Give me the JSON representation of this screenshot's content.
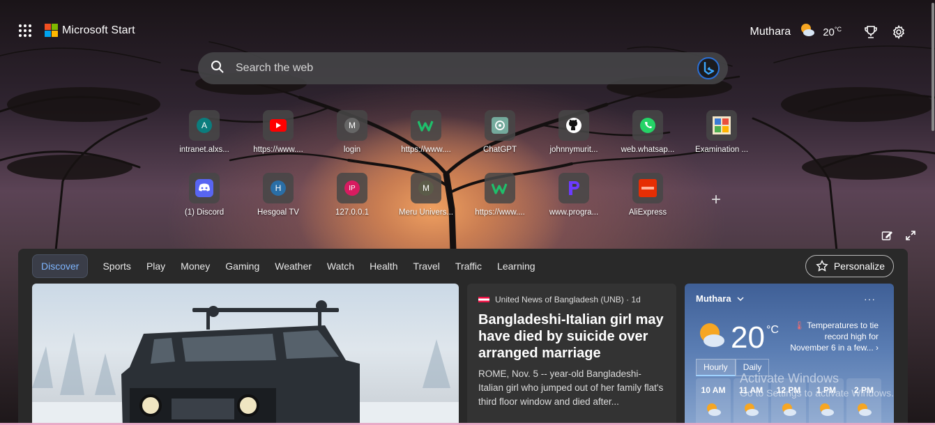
{
  "header": {
    "brand": "Microsoft Start",
    "user_name": "Muthara",
    "temperature": "20",
    "temperature_unit": "°C",
    "icons": [
      "apps-grid-icon",
      "microsoft-logo",
      "partly-sunny-icon",
      "rewards-trophy-icon",
      "gear-icon"
    ]
  },
  "search": {
    "placeholder": "Search the web",
    "icons": [
      "search-icon",
      "bing-icon"
    ]
  },
  "quick_links": {
    "row1": [
      {
        "label": "intranet.alxs...",
        "icon": "letter-a-icon",
        "letter": "A",
        "color": "#0b7d7d"
      },
      {
        "label": "https://www....",
        "icon": "youtube-icon"
      },
      {
        "label": "login",
        "icon": "letter-m-icon",
        "letter": "M",
        "color": "#666666"
      },
      {
        "label": "https://www....",
        "icon": "w-logo-icon"
      },
      {
        "label": "ChatGPT",
        "icon": "chatgpt-icon"
      },
      {
        "label": "johnnymurit...",
        "icon": "github-icon"
      },
      {
        "label": "web.whatsap...",
        "icon": "whatsapp-icon"
      },
      {
        "label": "Examination ...",
        "icon": "examination-thumbnail-icon"
      }
    ],
    "row2": [
      {
        "label": "(1) Discord",
        "icon": "discord-icon"
      },
      {
        "label": "Hesgoal TV",
        "icon": "letter-h-icon",
        "letter": "H",
        "color": "#2a6ea6"
      },
      {
        "label": "127.0.0.1",
        "icon": "letter-ip-icon",
        "letter": "IP",
        "color": "#d81b60"
      },
      {
        "label": "Meru Univers...",
        "icon": "letter-m-icon",
        "letter": "M",
        "color": "#5b5b48"
      },
      {
        "label": "https://www....",
        "icon": "w-logo-icon"
      },
      {
        "label": "www.progra...",
        "icon": "programiz-icon"
      },
      {
        "label": "AliExpress",
        "icon": "aliexpress-icon"
      }
    ],
    "add_icon": "plus-icon"
  },
  "feed": {
    "tabs": [
      "Discover",
      "Sports",
      "Play",
      "Money",
      "Gaming",
      "Weather",
      "Watch",
      "Health",
      "Travel",
      "Traffic",
      "Learning"
    ],
    "active_tab": "Discover",
    "personalize_label": "Personalize",
    "news": {
      "source": "United News of Bangladesh (UNB) · 1d",
      "headline": "Bangladeshi-Italian girl may have died by suicide over arranged marriage",
      "summary": "ROME, Nov. 5 -- year-old Bangladeshi-Italian girl who jumped out of her family flat's third floor window and died after..."
    },
    "weather": {
      "location": "Muthara",
      "temperature": "20",
      "unit": "°C",
      "note": "Temperatures to tie record high for November 6 in a few...",
      "tabs": [
        "Hourly",
        "Daily"
      ],
      "active_tab": "Hourly",
      "hours": [
        "10 AM",
        "11 AM",
        "12 PM",
        "1 PM",
        "2 PM"
      ]
    }
  },
  "watermark": {
    "title": "Activate Windows",
    "subtitle": "Go to Settings to activate Windows."
  },
  "colors": {
    "accent": "#7fb6ff",
    "feed_bg": "#292929",
    "card_bg": "#333333"
  }
}
